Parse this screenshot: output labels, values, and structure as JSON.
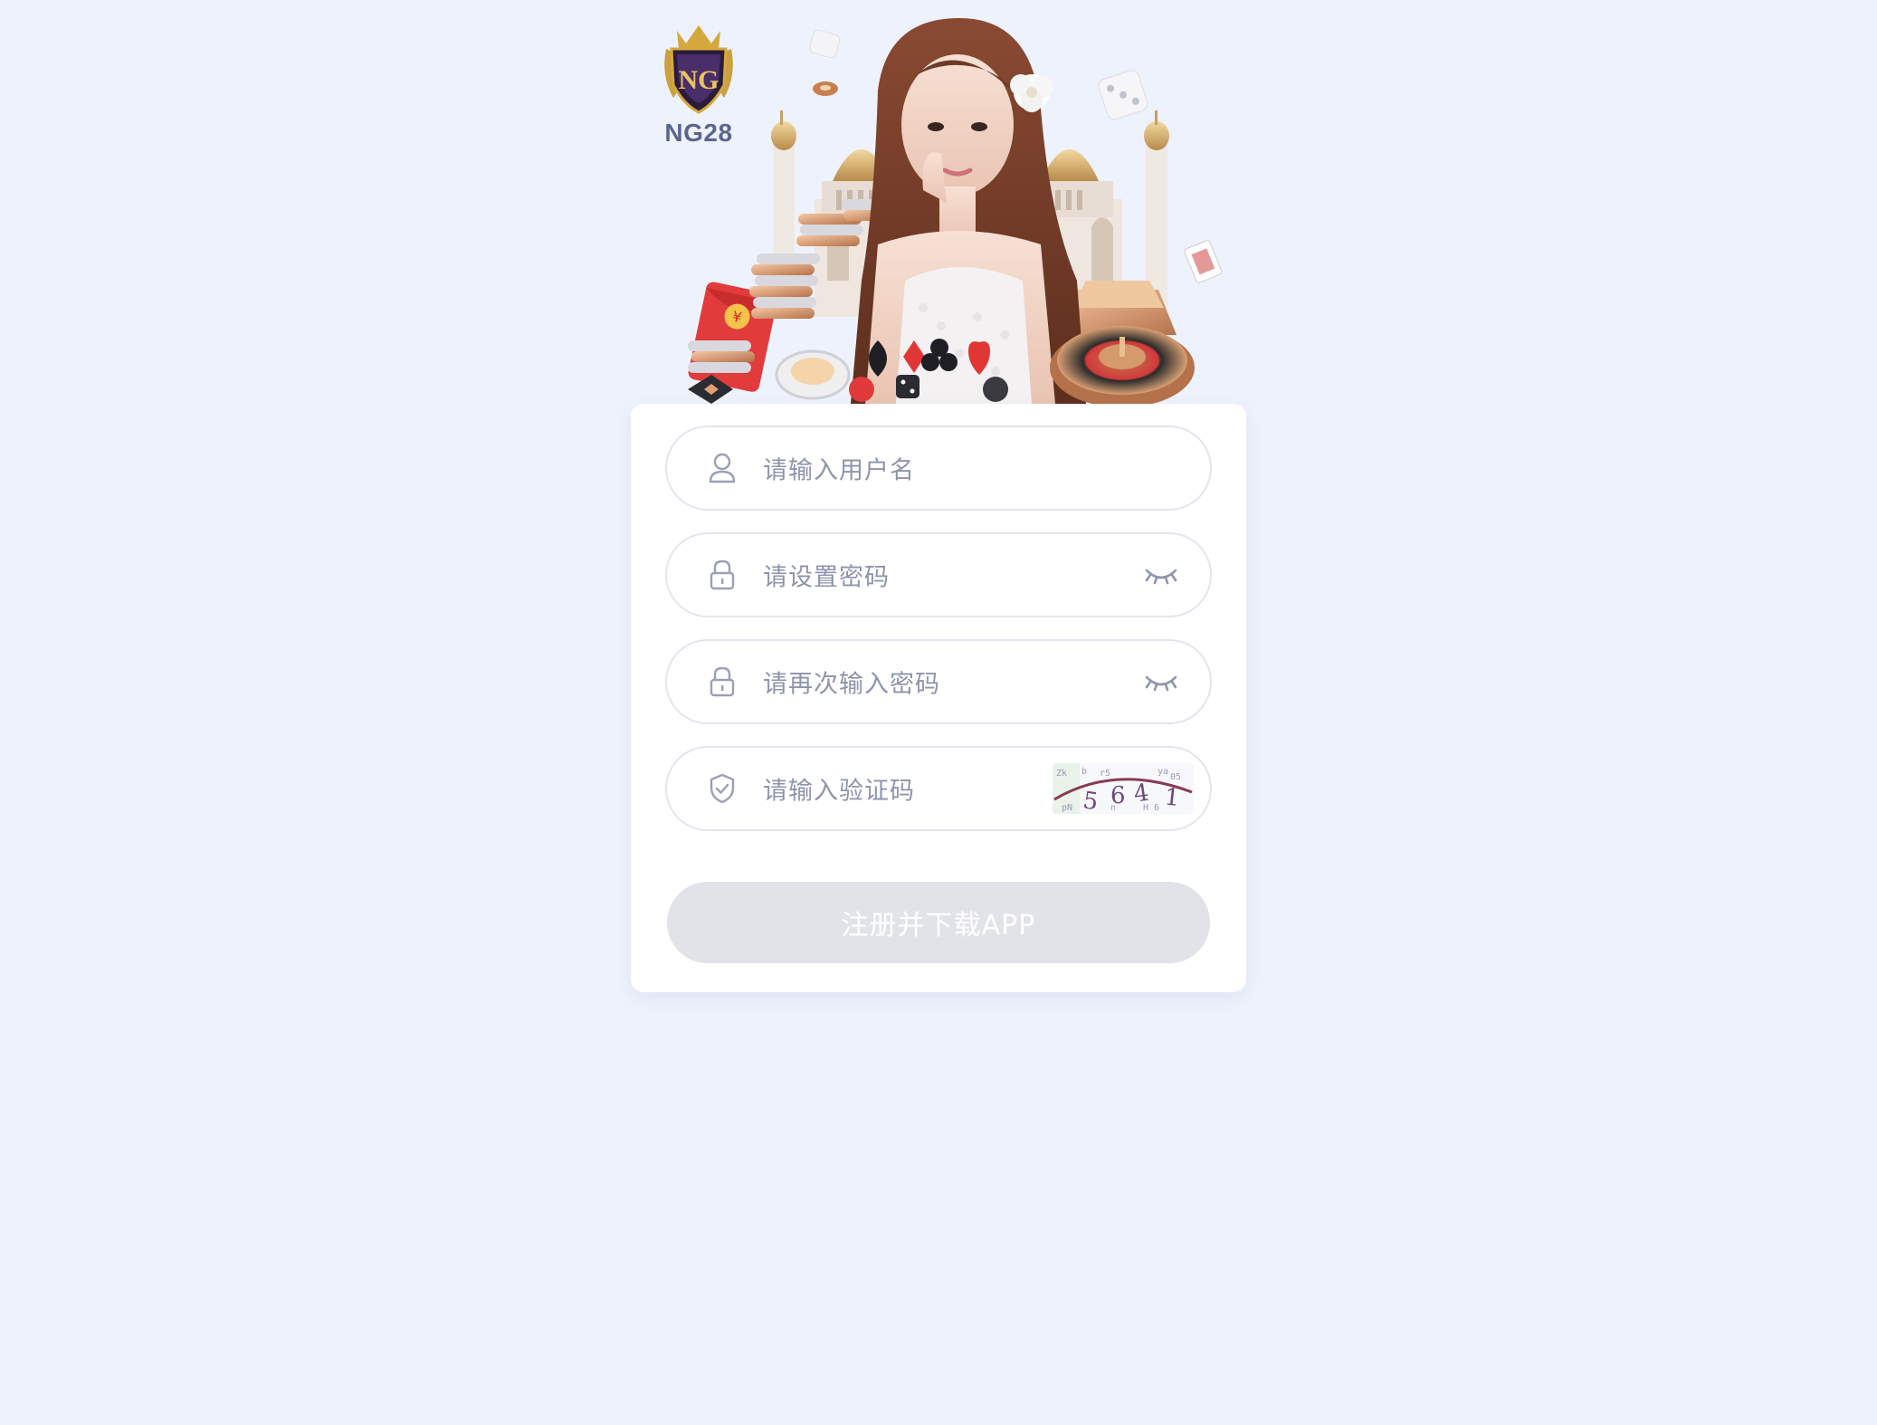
{
  "brand": {
    "name": "NG28",
    "badge_initials": "NG"
  },
  "form": {
    "username": {
      "placeholder": "请输入用户名",
      "icon": "user-icon"
    },
    "password": {
      "placeholder": "请设置密码",
      "icon": "lock-icon",
      "toggle_icon": "eye-closed-icon"
    },
    "password_confirm": {
      "placeholder": "请再次输入密码",
      "icon": "lock-icon",
      "toggle_icon": "eye-closed-icon"
    },
    "captcha": {
      "placeholder": "请输入验证码",
      "icon": "shield-check-icon",
      "code": "5641"
    },
    "submit_label": "注册并下载APP"
  },
  "colors": {
    "page_bg": "#eef2fc",
    "card_bg": "#ffffff",
    "field_border": "#e3e5ee",
    "placeholder": "#8d94ad",
    "submit_bg_disabled": "#e2e3e9",
    "brand_text": "#5a6690"
  }
}
